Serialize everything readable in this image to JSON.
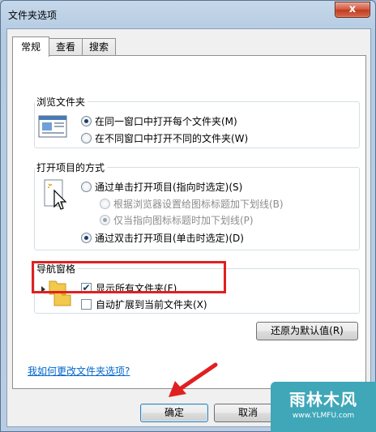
{
  "window": {
    "title": "文件夹选项",
    "close_label": "x"
  },
  "tabs": [
    {
      "label": "常规",
      "active": true
    },
    {
      "label": "查看",
      "active": false
    },
    {
      "label": "搜索",
      "active": false
    }
  ],
  "browse": {
    "title": "浏览文件夹",
    "option1": "在同一窗口中打开每个文件夹(M)",
    "option2": "在不同窗口中打开不同的文件夹(W)"
  },
  "open_items": {
    "title": "打开项目的方式",
    "single": "通过单击打开项目(指向时选定)(S)",
    "sub1": "根据浏览器设置给图标标题加下划线(B)",
    "sub2": "仅当指向图标标题时加下划线(P)",
    "double": "通过双击打开项目(单击时选定)(D)"
  },
  "nav": {
    "title": "导航窗格",
    "show_all": "显示所有文件夹(F)",
    "auto_expand": "自动扩展到当前文件夹(X)"
  },
  "restore_label": "还原为默认值(R)",
  "help_link": "我如何更改文件夹选项?",
  "buttons": {
    "ok": "确定",
    "cancel": "取消"
  },
  "watermark": {
    "title": "雨林木风",
    "url": "www.YLMFU.com"
  },
  "colors": {
    "highlight": "#e02020",
    "arrow": "#e02020",
    "link": "#0066cc"
  }
}
